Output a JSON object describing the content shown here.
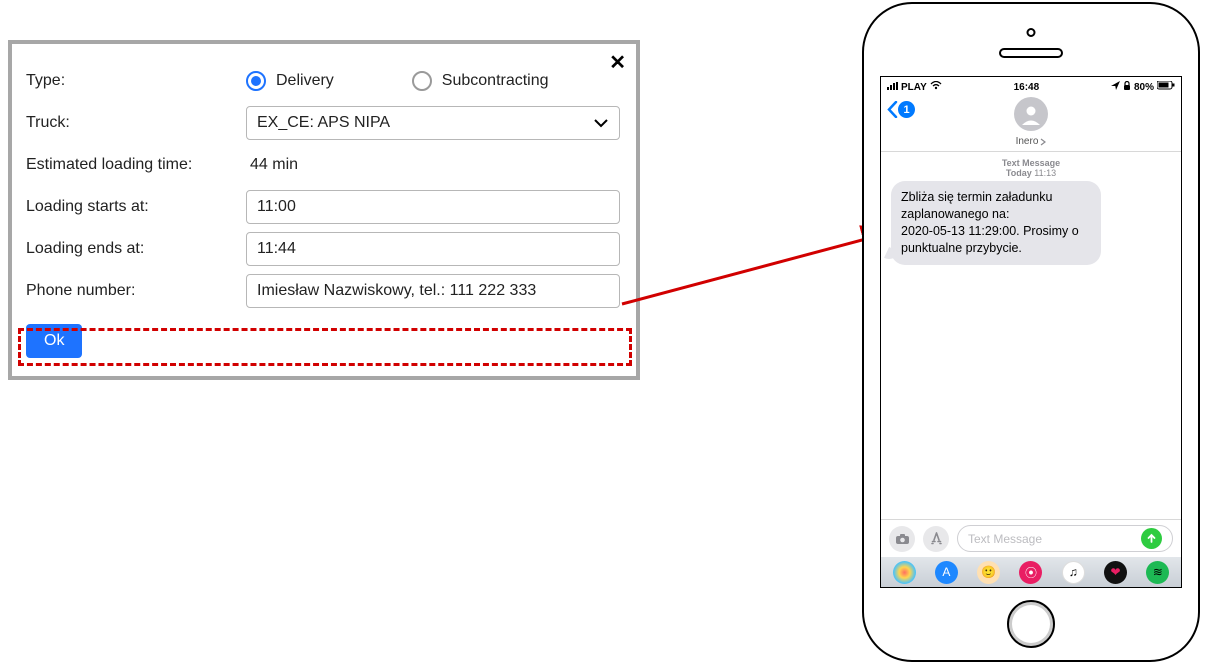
{
  "form": {
    "type_label": "Type:",
    "radio_delivery": "Delivery",
    "radio_subcontracting": "Subcontracting",
    "truck_label": "Truck:",
    "truck_value": "EX_CE: APS NIPA",
    "est_label": "Estimated loading time:",
    "est_value": "44 min",
    "start_label": "Loading starts at:",
    "start_value": "11:00",
    "end_label": "Loading ends at:",
    "end_value": "11:44",
    "phone_label": "Phone number:",
    "phone_value": "Imiesław Nazwiskowy, tel.: 111 222 333",
    "ok": "Ok"
  },
  "phone": {
    "carrier": "PLAY",
    "time": "16:48",
    "battery": "80%",
    "back_count": "1",
    "contact": "Inero",
    "msg_meta_label": "Text Message",
    "msg_meta_today": "Today",
    "msg_meta_time": "11:13",
    "bubble": "Zbliża się termin załadunku zaplanowanego na:\n2020-05-13 11:29:00. Prosimy o punktualne przybycie.",
    "input_placeholder": "Text Message"
  }
}
